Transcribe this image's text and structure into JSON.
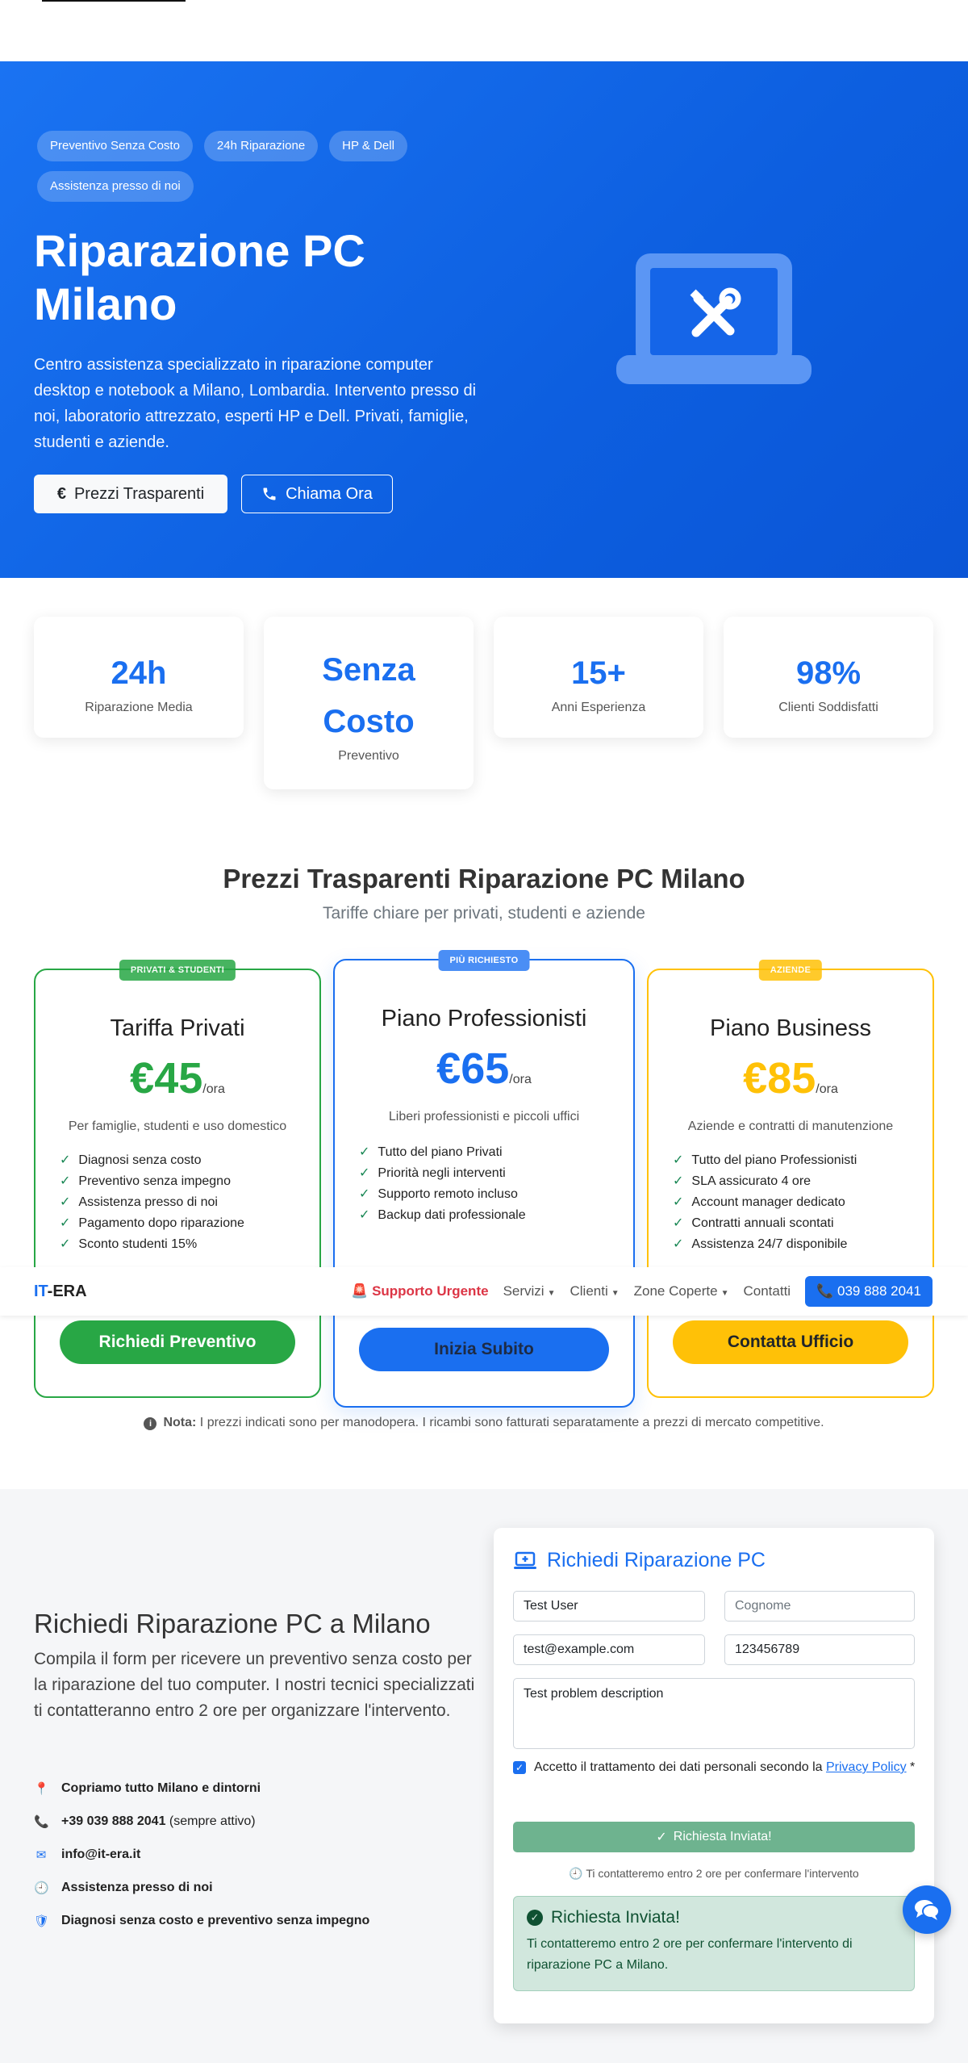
{
  "hero": {
    "badges": [
      "Preventivo Senza Costo",
      "24h Riparazione",
      "HP & Dell",
      "Assistenza presso di noi"
    ],
    "title_line1": "Riparazione PC",
    "title_line2": "Milano",
    "lead": "Centro assistenza specializzato in riparazione computer desktop e notebook a Milano, Lombardia. Intervento presso di noi, laboratorio attrezzato, esperti HP e Dell. Privati, famiglie, studenti e aziende.",
    "btn_prices": "Prezzi Trasparenti",
    "btn_call": "Chiama Ora",
    "icon": "laptop-tools-icon"
  },
  "stats": [
    {
      "num": "24h",
      "label": "Riparazione Media"
    },
    {
      "num": "Senza Costo",
      "label": "Preventivo"
    },
    {
      "num": "15+",
      "label": "Anni Esperienza"
    },
    {
      "num": "98%",
      "label": "Clienti Soddisfatti"
    }
  ],
  "pricing": {
    "title": "Prezzi Trasparenti Riparazione PC Milano",
    "subtitle": "Tariffe chiare per privati, studenti e aziende",
    "plans": [
      {
        "tag": "PRIVATI & STUDENTI",
        "name": "Tariffa Privati",
        "price": "€45",
        "unit": "/ora",
        "desc": "Per famiglie, studenti e uso domestico",
        "features": [
          "Diagnosi senza costo",
          "Preventivo senza impegno",
          "Assistenza presso di noi",
          "Pagamento dopo riparazione",
          "Sconto studenti 15%"
        ],
        "cta": "Richiedi Preventivo",
        "color": "#28a745"
      },
      {
        "tag": "PIÙ RICHIESTO",
        "name": "Piano Professionisti",
        "price": "€65",
        "unit": "/ora",
        "desc": "Liberi professionisti e piccoli uffici",
        "features": [
          "Tutto del piano Privati",
          "Priorità negli interventi",
          "Supporto remoto incluso",
          "Backup dati professionale"
        ],
        "cta": "Inizia Subito",
        "color": "#1a6ff0"
      },
      {
        "tag": "AZIENDE",
        "name": "Piano Business",
        "price": "€85",
        "unit": "/ora",
        "desc": "Aziende e contratti di manutenzione",
        "features": [
          "Tutto del piano Professionisti",
          "SLA assicurato 4 ore",
          "Account manager dedicato",
          "Contratti annuali scontati",
          "Assistenza 24/7 disponibile"
        ],
        "cta": "Contatta Ufficio",
        "color": "#ffc107"
      }
    ],
    "note_bold": "Nota:",
    "note_text": " I prezzi indicati sono per manodopera. I ricambi sono fatturati separatamente a prezzi di mercato competitive."
  },
  "navbar": {
    "brand_it": "IT",
    "brand_rest": "-ERA",
    "urgent": "Supporto Urgente",
    "links": [
      "Servizi",
      "Clienti",
      "Zone Coperte"
    ],
    "contact": "Contatti",
    "phone": "039 888 2041"
  },
  "contact": {
    "title": "Richiedi Riparazione PC a Milano",
    "intro": "Compila il form per ricevere un preventivo senza costo per la riparazione del tuo computer. I nostri tecnici specializzati ti contatteranno entro 2 ore per organizzare l'intervento.",
    "rows": [
      {
        "icon": "map-pin-icon",
        "bold": "Copriamo tutto Milano e dintorni",
        "text": ""
      },
      {
        "icon": "phone-icon",
        "bold": "+39 039 888 2041",
        "text": " (sempre attivo)"
      },
      {
        "icon": "envelope-icon",
        "bold": "info@it-era.it",
        "text": ""
      },
      {
        "icon": "clock-icon",
        "bold": "Assistenza presso di noi",
        "text": ""
      },
      {
        "icon": "shield-icon",
        "bold": "Diagnosi senza costo e preventivo senza impegno",
        "text": ""
      }
    ]
  },
  "form": {
    "title": "Richiedi Riparazione PC",
    "name_value": "Test User",
    "surname_placeholder": "Cognome",
    "email_value": "test@example.com",
    "phone_value": "123456789",
    "problem_value": "Test problem description",
    "privacy_text": "Accetto il trattamento dei dati personali secondo la ",
    "privacy_link": "Privacy Policy",
    "privacy_req": " *",
    "submit_label": "Richiesta Inviata!",
    "small_note": "Ti contatteremo entro 2 ore per confermare l'intervento",
    "alert_title": "Richiesta Inviata!",
    "alert_body": "Ti contatteremo entro 2 ore per confermare l'intervento di riparazione PC a Milano."
  },
  "colors": {
    "primary": "#1a6ff0",
    "success": "#28a745",
    "warning": "#ffc107",
    "danger": "#dc3545"
  }
}
